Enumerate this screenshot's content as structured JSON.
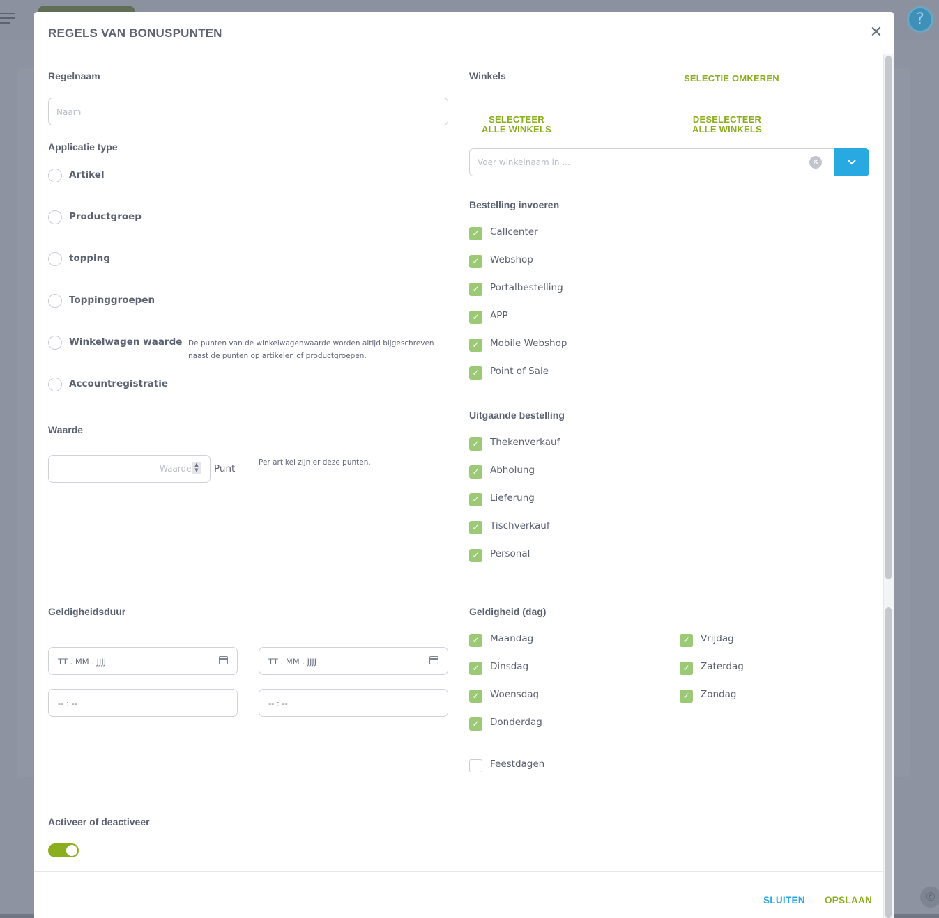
{
  "modal": {
    "title": "REGELS VAN BONUSPUNTEN",
    "close_icon": "close-icon"
  },
  "left": {
    "rule_name_label": "Regelnaam",
    "rule_name_placeholder": "Naam",
    "app_type_label": "Applicatie type",
    "app_type_options": [
      "Artikel",
      "Productgroep",
      "topping",
      "Toppinggroepen",
      "Winkelwagen waarde",
      "Accountregistratie"
    ],
    "cart_value_note": "De punten van de winkelwagenwaarde worden altijd bijgeschreven naast de punten op artikelen of productgroepen.",
    "value_label": "Waarde",
    "value_placeholder": "Waarde",
    "value_unit": "Punt",
    "value_note": "Per artikel zijn er deze punten.",
    "validity_label": "Geldigheidsduur",
    "date_from_placeholder": "TT . MM . JJJJ",
    "date_to_placeholder": "TT . MM . JJJJ",
    "time_from_placeholder": "-- : --",
    "time_to_placeholder": "-- : --",
    "activate_label": "Activeer of deactiveer",
    "active": true
  },
  "right": {
    "stores_label": "Winkels",
    "invert_selection": "SELECTIE OMKEREN",
    "select_all_line1": "SELECTEER",
    "select_all_line2": "ALLE WINKELS",
    "deselect_all_line1": "DESELECTEER",
    "deselect_all_line2": "ALLE WINKELS",
    "store_search_placeholder": "Voer winkelnaam in ...",
    "order_input_label": "Bestelling invoeren",
    "order_input_options": [
      "Callcenter",
      "Webshop",
      "Portalbestelling",
      "APP",
      "Mobile Webshop",
      "Point of Sale"
    ],
    "outgoing_label": "Uitgaande bestelling",
    "outgoing_options": [
      "Thekenverkauf",
      "Abholung",
      "Lieferung",
      "Tischverkauf",
      "Personal"
    ],
    "validity_day_label": "Geldigheid (dag)",
    "days_col1": [
      "Maandag",
      "Dinsdag",
      "Woensdag",
      "Donderdag"
    ],
    "days_col2": [
      "Vrijdag",
      "Zaterdag",
      "Zondag"
    ],
    "holidays": "Feestdagen"
  },
  "footer": {
    "close": "SLUITEN",
    "save": "OPSLAAN"
  },
  "colors": {
    "accent_green": "#8bae1f",
    "check_green": "#9cc976",
    "blue": "#28a9e1"
  }
}
